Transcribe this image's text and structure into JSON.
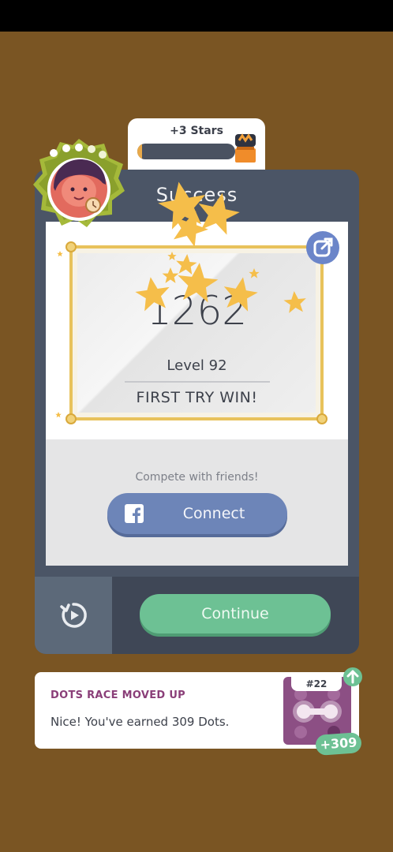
{
  "stars_panel": {
    "label": "+3 Stars",
    "progress": 0.05
  },
  "card": {
    "title": "Success",
    "score": "1262",
    "level": "Level 92",
    "result": "FIRST TRY WIN!",
    "compete_text": "Compete with friends!",
    "connect_label": "Connect",
    "continue_label": "Continue"
  },
  "notification": {
    "title": "DOTS RACE MOVED UP",
    "message": "Nice! You've earned 309 Dots.",
    "rank": "#22",
    "earned": "+309"
  },
  "icons": [
    "avatar",
    "treasure-chest-icon",
    "share-icon",
    "facebook-icon",
    "replay-icon",
    "arrow-up-icon",
    "star-icon"
  ],
  "colors": {
    "background": "#7a5523",
    "card": "#4b5566",
    "gold": "#e8c25b",
    "star": "#f5be4a",
    "facebook": "#6d85b8",
    "continue": "#6dc194",
    "race_title": "#8a3e78"
  }
}
